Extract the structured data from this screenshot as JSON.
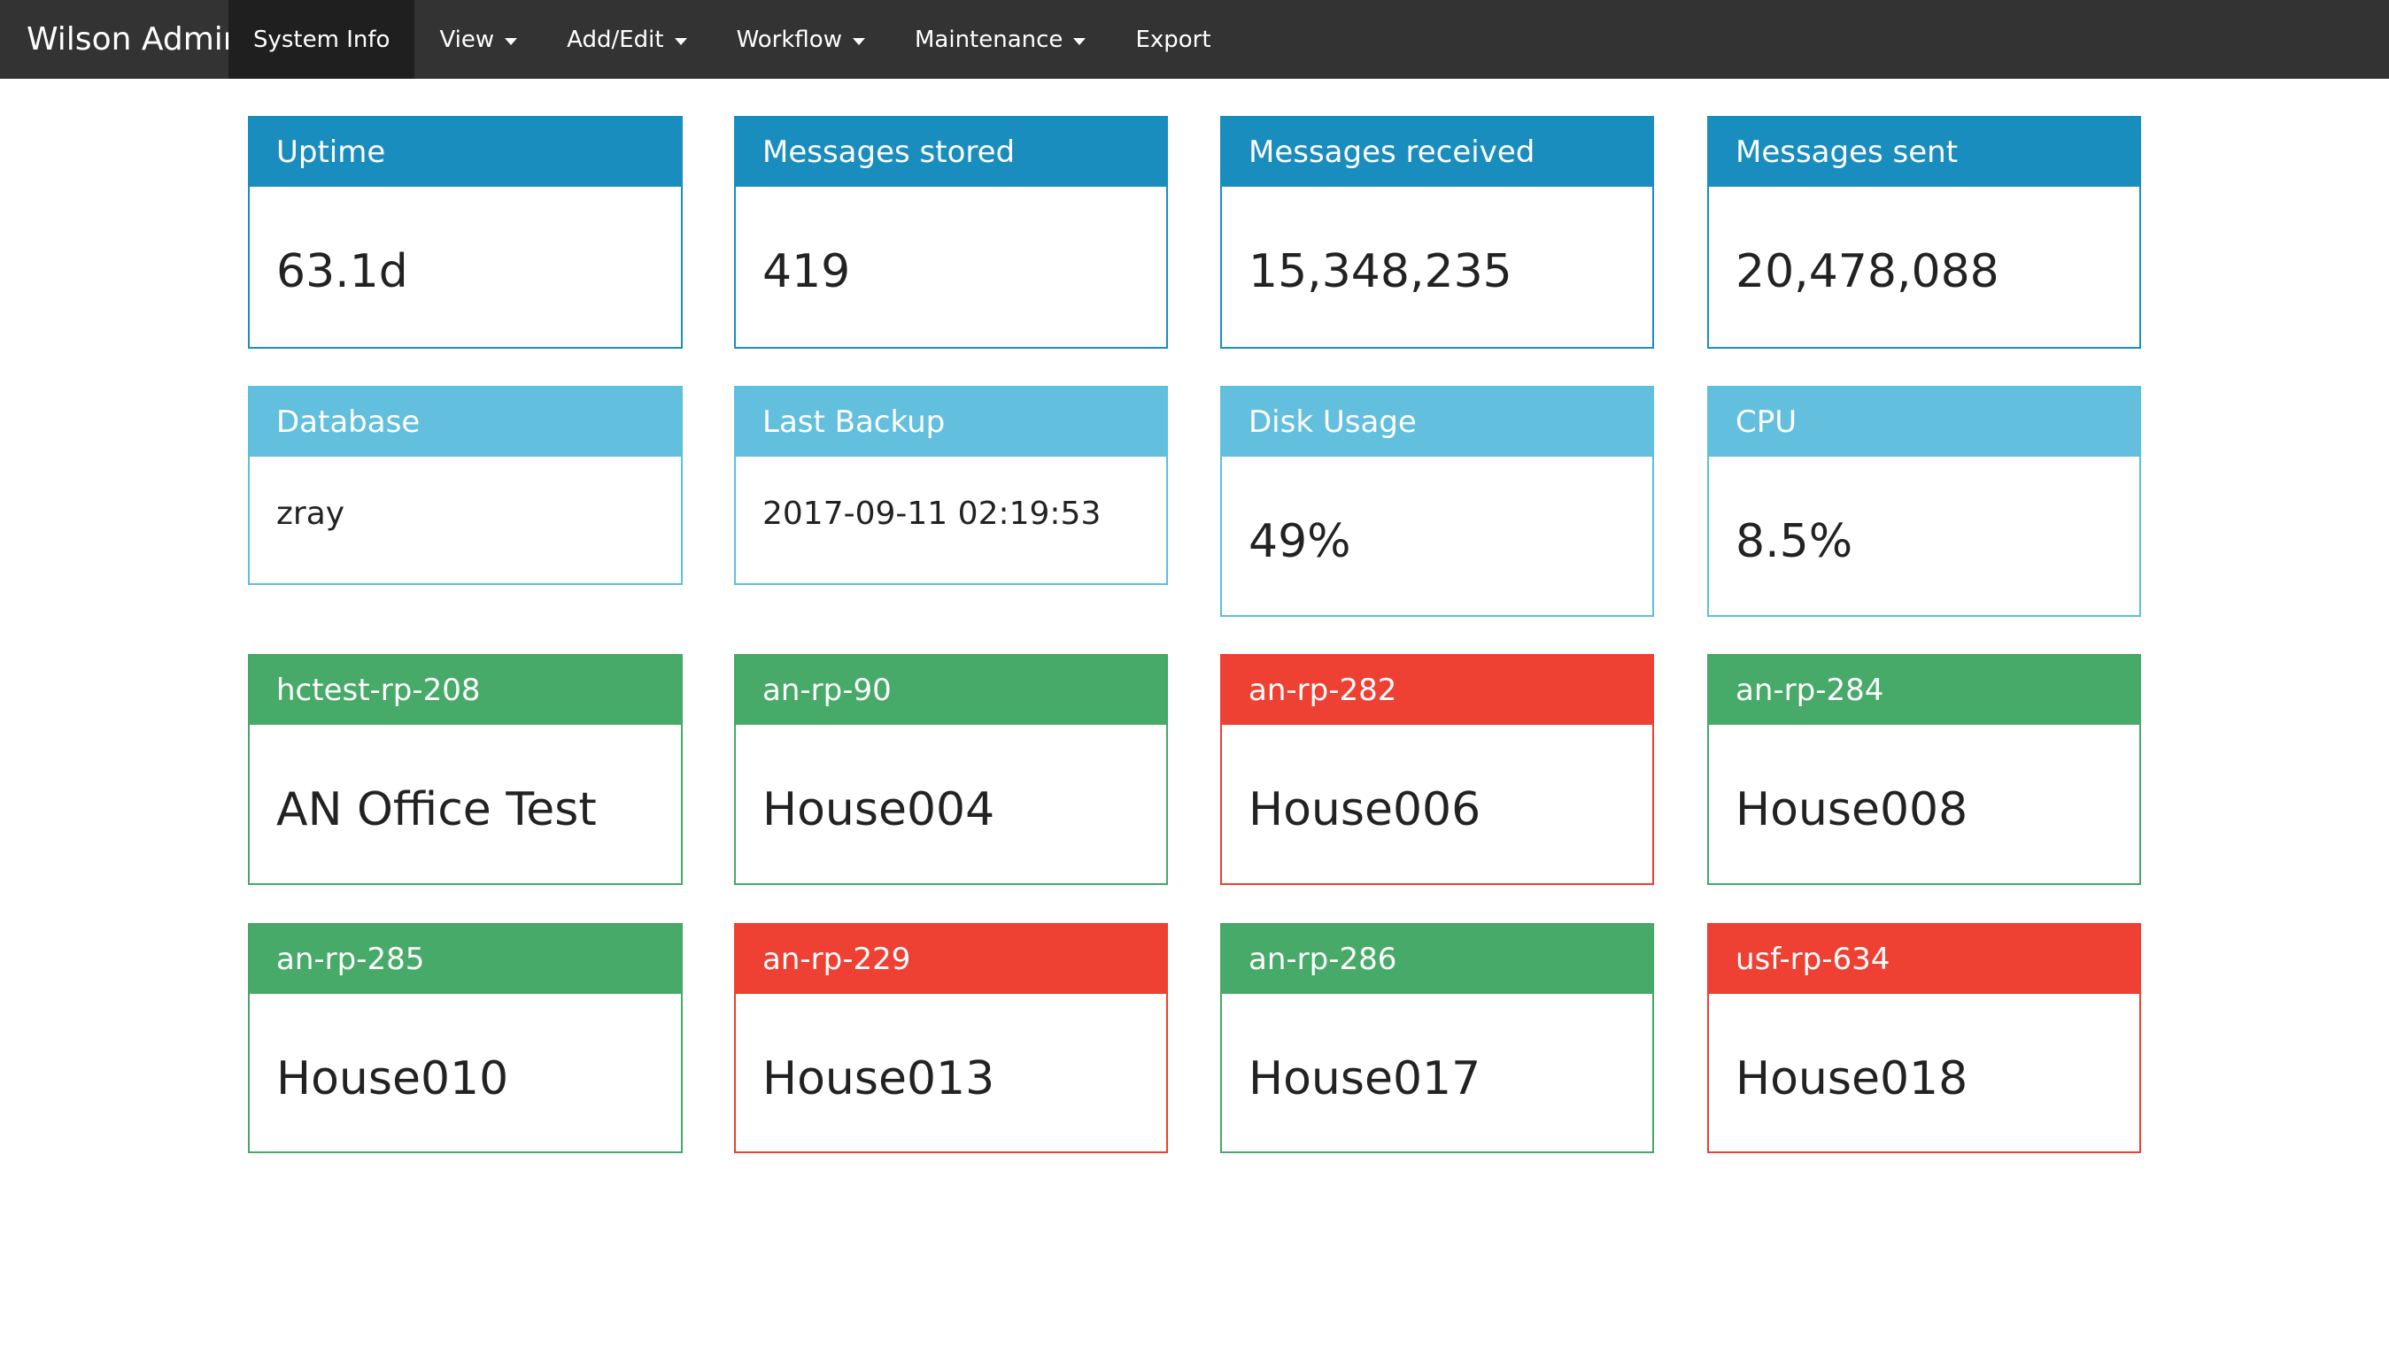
{
  "app": {
    "brand": "Wilson Admin"
  },
  "nav": {
    "items": [
      {
        "label": "System Info",
        "dropdown": false,
        "active": true
      },
      {
        "label": "View",
        "dropdown": true,
        "active": false
      },
      {
        "label": "Add/Edit",
        "dropdown": true,
        "active": false
      },
      {
        "label": "Workflow",
        "dropdown": true,
        "active": false
      },
      {
        "label": "Maintenance",
        "dropdown": true,
        "active": false
      },
      {
        "label": "Export",
        "dropdown": false,
        "active": false
      }
    ]
  },
  "colors": {
    "primary": "#1a8dbf",
    "info": "#62bfdd",
    "ok": "#47aa69",
    "bad": "#ee4033",
    "navbar": "#333333"
  },
  "stats": [
    {
      "title": "Uptime",
      "value": "63.1d",
      "style": "primary"
    },
    {
      "title": "Messages stored",
      "value": "419",
      "style": "primary"
    },
    {
      "title": "Messages received",
      "value": "15,348,235",
      "style": "primary"
    },
    {
      "title": "Messages sent",
      "value": "20,478,088",
      "style": "primary"
    }
  ],
  "system": [
    {
      "title": "Database",
      "value": "zray",
      "style": "info"
    },
    {
      "title": "Last Backup",
      "value": "2017-09-11 02:19:53",
      "style": "info"
    },
    {
      "title": "Disk Usage",
      "value": "49%",
      "style": "info"
    },
    {
      "title": "CPU",
      "value": "8.5%",
      "style": "info"
    }
  ],
  "devices_row1": [
    {
      "id": "hctest-rp-208",
      "name": "AN Office Test",
      "status": "ok"
    },
    {
      "id": "an-rp-90",
      "name": "House004",
      "status": "ok"
    },
    {
      "id": "an-rp-282",
      "name": "House006",
      "status": "bad"
    },
    {
      "id": "an-rp-284",
      "name": "House008",
      "status": "ok"
    }
  ],
  "devices_row2": [
    {
      "id": "an-rp-285",
      "name": "House010",
      "status": "ok"
    },
    {
      "id": "an-rp-229",
      "name": "House013",
      "status": "bad"
    },
    {
      "id": "an-rp-286",
      "name": "House017",
      "status": "ok"
    },
    {
      "id": "usf-rp-634",
      "name": "House018",
      "status": "bad"
    }
  ]
}
